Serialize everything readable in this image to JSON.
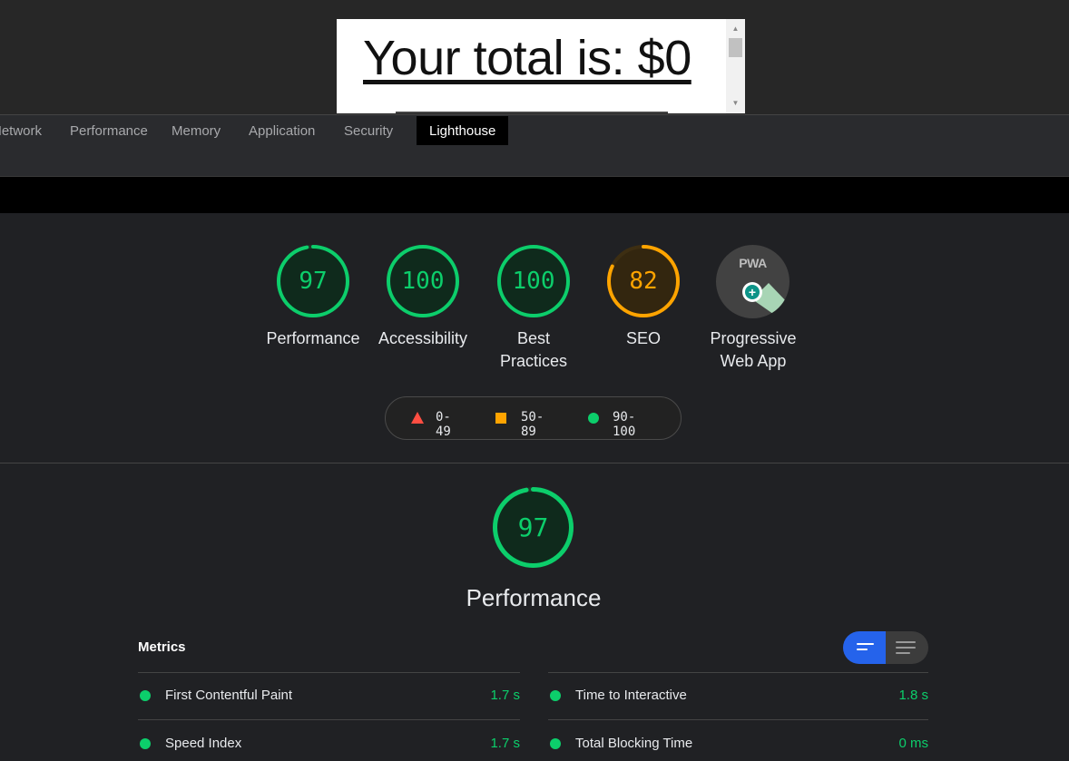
{
  "preview": {
    "text": "Your total is: $0"
  },
  "tabs": [
    {
      "label": "Network"
    },
    {
      "label": "Performance"
    },
    {
      "label": "Memory"
    },
    {
      "label": "Application"
    },
    {
      "label": "Security"
    },
    {
      "label": "Lighthouse",
      "active": true
    }
  ],
  "gauges": [
    {
      "score": "97",
      "label": "Performance",
      "status": "pass"
    },
    {
      "score": "100",
      "label": "Accessibility",
      "status": "pass"
    },
    {
      "score": "100",
      "label": "Best Practices",
      "status": "pass"
    },
    {
      "score": "82",
      "label": "SEO",
      "status": "average"
    },
    {
      "label": "Progressive Web App",
      "badge_text": "PWA",
      "badge_icon": "plus-icon"
    }
  ],
  "legend": [
    {
      "range": "0-49",
      "icon": "triangle-icon",
      "color": "#ff4e42"
    },
    {
      "range": "50-89",
      "icon": "square-icon",
      "color": "#ffa400"
    },
    {
      "range": "90-100",
      "icon": "circle-icon",
      "color": "#0cce6b"
    }
  ],
  "performance": {
    "score": "97",
    "title": "Performance",
    "metrics_title": "Metrics",
    "metrics": [
      {
        "name": "First Contentful Paint",
        "value": "1.7 s"
      },
      {
        "name": "Time to Interactive",
        "value": "1.8 s"
      },
      {
        "name": "Speed Index",
        "value": "1.7 s"
      },
      {
        "name": "Total Blocking Time",
        "value": "0 ms"
      }
    ]
  },
  "colors": {
    "pass": "#0cce6b",
    "average": "#ffa400",
    "fail": "#ff4e42",
    "toggle_active": "#2563eb"
  }
}
